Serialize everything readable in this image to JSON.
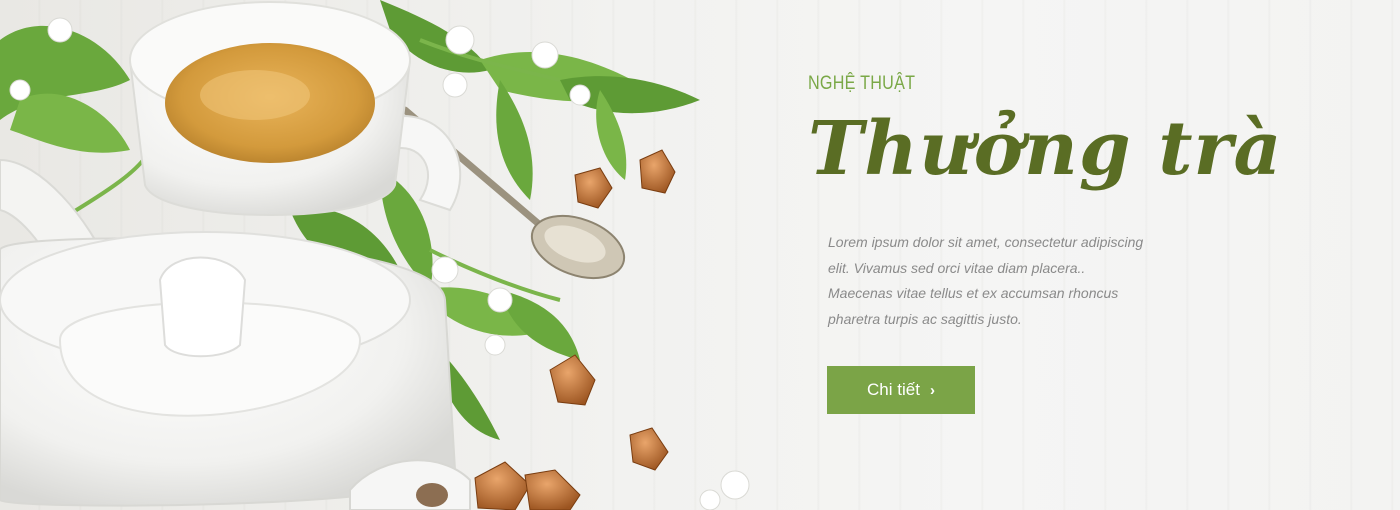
{
  "hero": {
    "eyebrow": "NGHỆ THUẬT",
    "headline": "Thưởng trà",
    "description": "Lorem ipsum dolor sit amet, consectetur adipiscing elit. Vivamus sed orci vitae diam placera.. Maecenas vitae tellus et ex accumsan rhoncus  pharetra turpis ac sagittis justo.",
    "cta_label": "Chi tiết",
    "cta_icon": "chevron-right-icon"
  },
  "colors": {
    "accent": "#7ba447",
    "headline": "#5a6d24",
    "eyebrow": "#7aa847",
    "body_text": "#8a8a8a",
    "background": "#f2f2f0"
  }
}
